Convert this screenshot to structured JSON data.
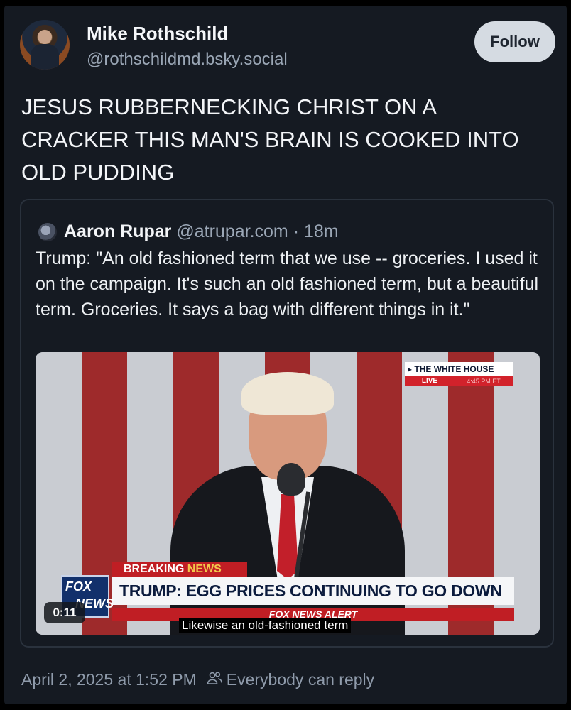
{
  "post": {
    "author_name": "Mike Rothschild",
    "author_handle": "@rothschildmd.bsky.social",
    "follow_label": "Follow",
    "text": "JESUS RUBBERNECKING CHRIST ON A CRACKER THIS MAN'S BRAIN IS COOKED INTO OLD PUDDING",
    "date": "April 2, 2025 at 1:52 PM",
    "reply_setting": "Everybody can reply"
  },
  "quote": {
    "author_name": "Aaron Rupar",
    "author_handle": "@atrupar.com",
    "separator": " · ",
    "time": "18m",
    "text": "Trump: \"An old fashioned term that we use -- groceries. I used it on the campaign. It's such an old fashioned term, but a beautiful term. Groceries. It says a bag with different things in it.\"",
    "video": {
      "timestamp": "0:11",
      "bug_title": "THE WHITE HOUSE",
      "bug_live": "LIVE",
      "bug_time": "4:45 PM ET",
      "breaking_label_1": "BREAKING ",
      "breaking_label_2": "NEWS",
      "headline": "TRUMP: EGG PRICES CONTINUING TO GO DOWN",
      "alert_bar": "FOX NEWS ALERT",
      "network_logo_1": "FOX",
      "network_logo_2": "NEWS",
      "caption": "Likewise an old-fashioned term"
    }
  },
  "icons": [
    "people-icon"
  ],
  "colors": {
    "background": "#151a22",
    "follow_bg": "#d5dbe2",
    "muted_text": "#9aa6b5",
    "fox_red": "#c01e24",
    "fox_blue": "#12306b"
  }
}
